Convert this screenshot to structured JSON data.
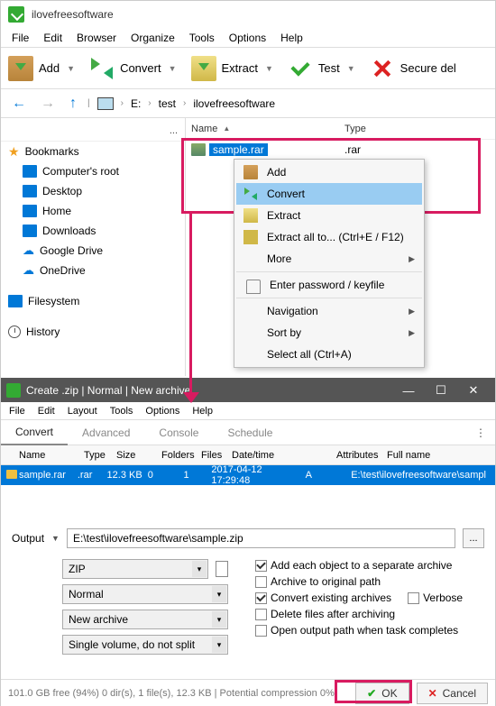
{
  "window1": {
    "title": "ilovefreesoftware",
    "menu": [
      "File",
      "Edit",
      "Browser",
      "Organize",
      "Tools",
      "Options",
      "Help"
    ],
    "toolbar": {
      "add": "Add",
      "convert": "Convert",
      "extract": "Extract",
      "test": "Test",
      "secure": "Secure del"
    },
    "breadcrumb": [
      "E:",
      "test",
      "ilovefreesoftware"
    ],
    "cols": {
      "name": "Name",
      "type": "Type"
    },
    "file": {
      "name": "sample.rar",
      "type": ".rar"
    },
    "sidebar": {
      "dots": "...",
      "bookmarks": "Bookmarks",
      "items": [
        "Computer's root",
        "Desktop",
        "Home",
        "Downloads",
        "Google Drive",
        "OneDrive"
      ],
      "filesystem": "Filesystem",
      "history": "History"
    }
  },
  "context": {
    "add": "Add",
    "convert": "Convert",
    "extract": "Extract",
    "extractall": "Extract all to... (Ctrl+E / F12)",
    "more": "More",
    "enterpw": "Enter password / keyfile",
    "navigation": "Navigation",
    "sortby": "Sort by",
    "selectall": "Select all (Ctrl+A)"
  },
  "window2": {
    "title": "Create .zip | Normal | New archive",
    "menu": [
      "File",
      "Edit",
      "Layout",
      "Tools",
      "Options",
      "Help"
    ],
    "tabs": [
      "Convert",
      "Advanced",
      "Console",
      "Schedule"
    ],
    "cols": {
      "name": "Name",
      "type": "Type",
      "size": "Size",
      "folders": "Folders",
      "files": "Files",
      "datetime": "Date/time",
      "attributes": "Attributes",
      "fullname": "Full name"
    },
    "row": {
      "name": "sample.rar",
      "type": ".rar",
      "size": "12.3 KB",
      "folders": "0",
      "files": "1",
      "datetime": "2017-04-12 17:29:48",
      "attributes": "A",
      "fullname": "E:\\test\\ilovefreesoftware\\sampl"
    },
    "output": {
      "label": "Output",
      "path": "E:\\test\\ilovefreesoftware\\sample.zip",
      "browse": "..."
    },
    "selects": {
      "format": "ZIP",
      "level": "Normal",
      "mode": "New archive",
      "split": "Single volume, do not split"
    },
    "checks": {
      "separate": "Add each object to a separate archive",
      "orig": "Archive to original path",
      "convex": "Convert existing archives",
      "verbose": "Verbose",
      "delafter": "Delete files after archiving",
      "openout": "Open output path when task completes"
    },
    "status": "101.0 GB free (94%)   0 dir(s), 1 file(s), 12.3 KB | Potential compression 0%",
    "ok": "OK",
    "cancel": "Cancel"
  }
}
